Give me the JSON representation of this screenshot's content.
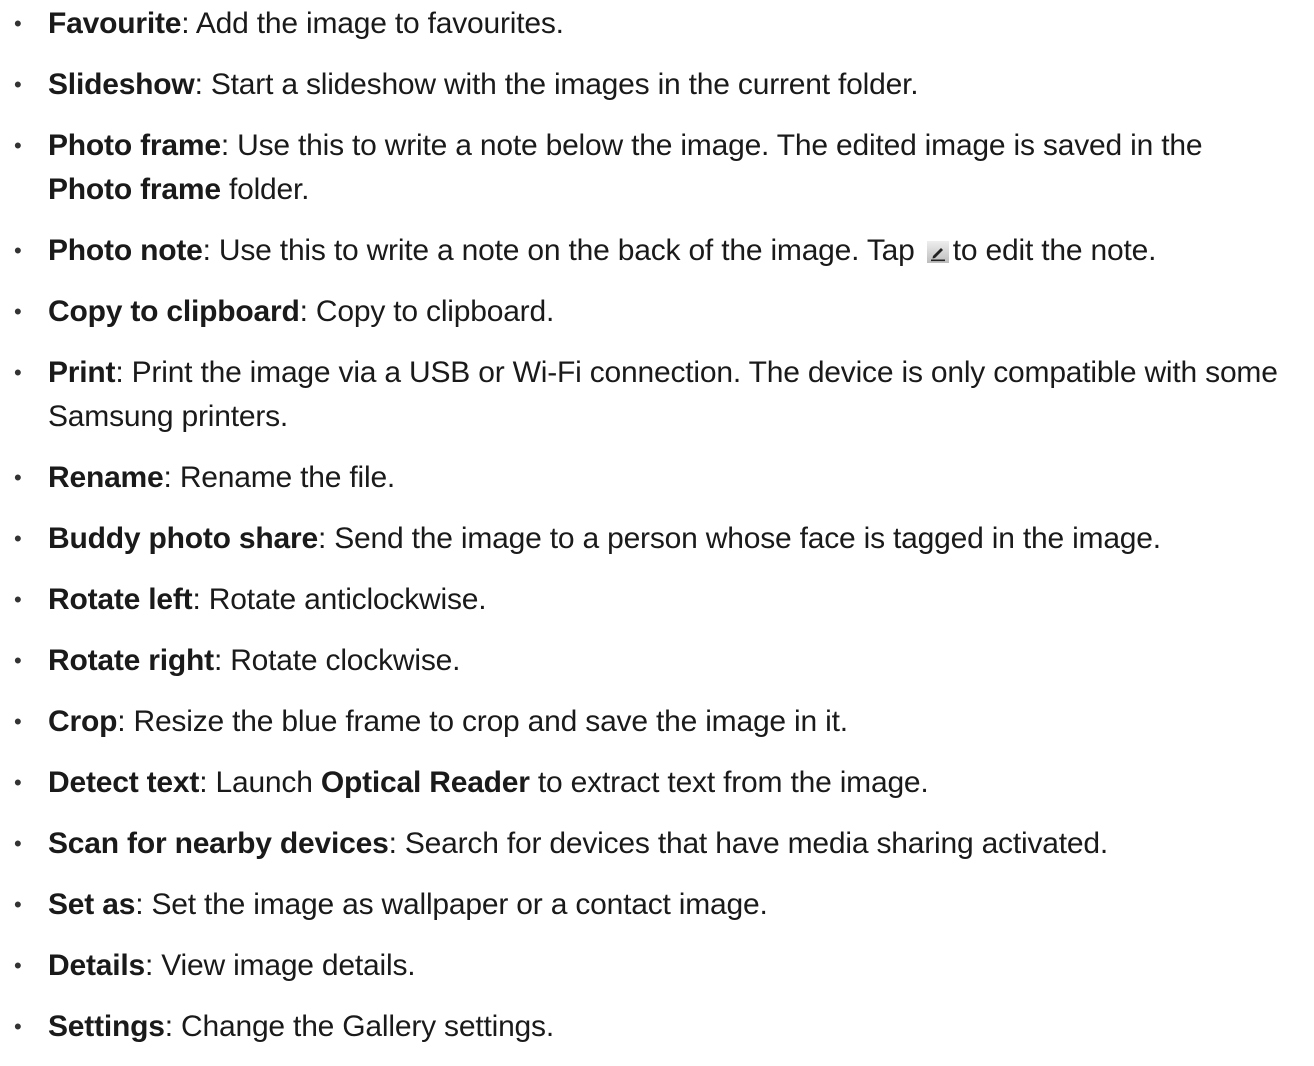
{
  "items": [
    {
      "term": "Favourite",
      "sep": ": ",
      "text": "Add the image to favourites."
    },
    {
      "term": "Slideshow",
      "sep": ": ",
      "text": "Start a slideshow with the images in the current folder."
    },
    {
      "term": "Photo frame",
      "sep": ": ",
      "text": "Use this to write a note below the image. The edited image is saved in the",
      "term2": "Photo frame",
      "text2": " folder."
    },
    {
      "term": "Photo note",
      "sep": ": ",
      "text": "Use this to write a note on the back of the image. Tap",
      "icon": "edit-note-icon",
      "text2": "to edit the note."
    },
    {
      "term": "Copy to clipboard",
      "sep": ": ",
      "text": "Copy to clipboard."
    },
    {
      "term": "Print",
      "sep": ": ",
      "text": "Print the image via a USB or Wi-Fi connection. The device is only compatible with some Samsung printers."
    },
    {
      "term": "Rename",
      "sep": ": ",
      "text": "Rename the file."
    },
    {
      "term": "Buddy photo share",
      "sep": ": ",
      "text": "Send the image to a person whose face is tagged in the image."
    },
    {
      "term": "Rotate left",
      "sep": ": ",
      "text": "Rotate anticlockwise."
    },
    {
      "term": "Rotate right",
      "sep": ": ",
      "text": "Rotate clockwise."
    },
    {
      "term": "Crop",
      "sep": ": ",
      "text": "Resize the blue frame to crop and save the image in it."
    },
    {
      "term": "Detect text",
      "sep": ": ",
      "text": "Launch ",
      "term2": "Optical Reader",
      "text2": " to extract text from the image."
    },
    {
      "term": "Scan for nearby devices",
      "sep": ": ",
      "text": "Search for devices that have media sharing activated."
    },
    {
      "term": "Set as",
      "sep": ": ",
      "text": "Set the image as wallpaper or a contact image."
    },
    {
      "term": "Details",
      "sep": ": ",
      "text": "View image details."
    },
    {
      "term": "Settings",
      "sep": ": ",
      "text": "Change the Gallery settings."
    }
  ],
  "bullet": "•",
  "colors": {
    "text": "#1a1a1a",
    "icon_bg": "#d4d4d4",
    "icon_stroke": "#222222"
  }
}
